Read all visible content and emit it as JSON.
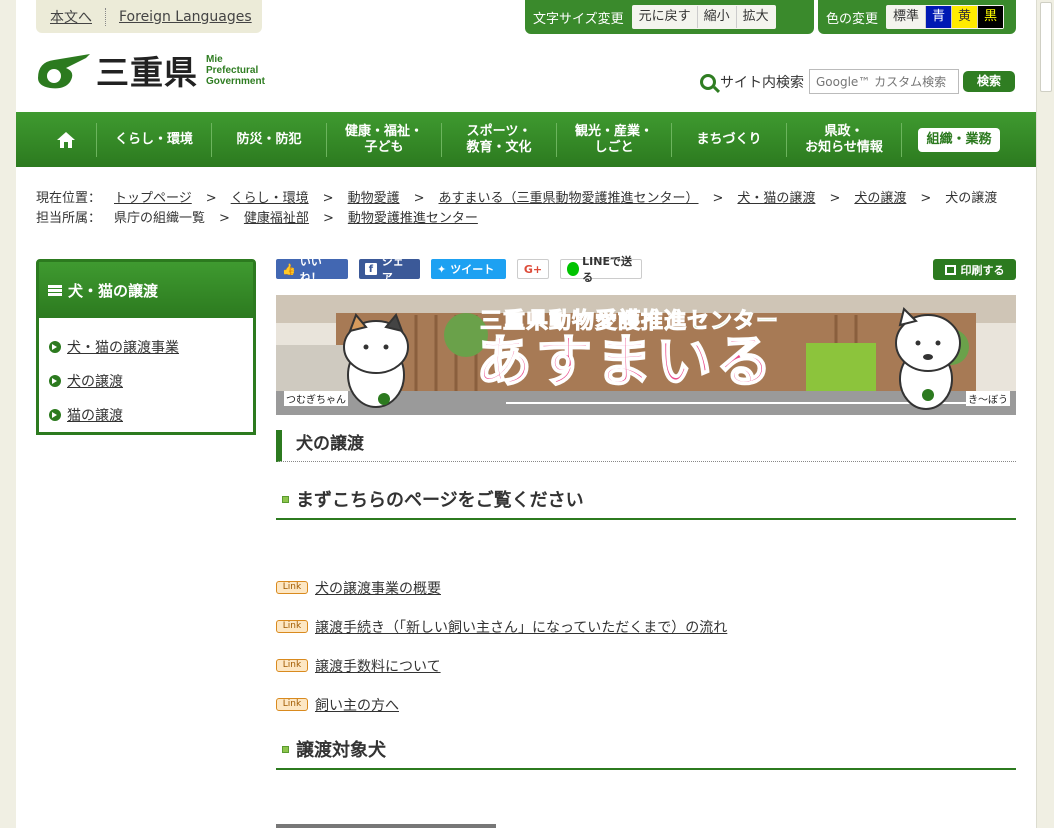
{
  "skip_links": {
    "main_text": "本文へ",
    "foreign": "Foreign Languages"
  },
  "font_size_tool": {
    "label": "文字サイズ変更",
    "buttons": [
      "元に戻す",
      "縮小",
      "拡大"
    ]
  },
  "color_tool": {
    "label": "色の変更",
    "buttons": [
      "標準",
      "青",
      "黄",
      "黒"
    ]
  },
  "logo": {
    "name": "三重県",
    "en_line1": "Mie",
    "en_line2": "Prefectural",
    "en_line3": "Government"
  },
  "search": {
    "label": "サイト内検索",
    "placeholder": "Google™ カスタム検索",
    "button": "検索"
  },
  "global_nav": [
    {
      "label": "くらし・環境"
    },
    {
      "label": "防災・防犯"
    },
    {
      "label": "健康・福祉・\n子ども"
    },
    {
      "label": "スポーツ・\n教育・文化"
    },
    {
      "label": "観光・産業・\nしごと"
    },
    {
      "label": "まちづくり"
    },
    {
      "label": "県政・\nお知らせ情報"
    },
    {
      "label": "組織・業務"
    }
  ],
  "breadcrumb": {
    "current_label": "現在位置：",
    "current_items": [
      "トップページ",
      "くらし・環境",
      "動物愛護",
      "あすまいる（三重県動物愛護推進センター）",
      "犬・猫の譲渡",
      "犬の譲渡",
      "犬の譲渡"
    ],
    "dept_label": "担当所属：",
    "dept_items": [
      "県庁の組織一覧",
      "健康福祉部",
      "動物愛護推進センター"
    ],
    "gt": ">"
  },
  "side_nav": {
    "title": "犬・猫の譲渡",
    "items": [
      "犬・猫の譲渡事業",
      "犬の譲渡",
      "猫の譲渡"
    ]
  },
  "social": {
    "like": "いいね！",
    "share": "シェア",
    "tweet": "ツイート",
    "gplus": "G+",
    "line": "LINEで送る",
    "print": "印刷する"
  },
  "banner": {
    "title": "三重県動物愛護推進センター",
    "logo_text": "あすまいる",
    "char_left": "つむぎちゃん",
    "char_right": "き～ぼう",
    "colors": {
      "a": "#e94b8a",
      "su": "#2a9fd8",
      "ma": "#e94b8a",
      "i": "#f7b500",
      "ru": "#8a4fc2"
    }
  },
  "content": {
    "page_title": "犬の譲渡",
    "section1": "まずこちらのページをご覧ください",
    "link_tag": "Link",
    "links": [
      "犬の譲渡事業の概要",
      "譲渡手続き（「新しい飼い主さん」になっていただくまで）の流れ",
      "譲渡手数料について",
      "飼い主の方へ"
    ],
    "section2": "譲渡対象犬"
  },
  "colors": {
    "brand_green": "#2c7a1f",
    "background": "#f0efe3"
  }
}
